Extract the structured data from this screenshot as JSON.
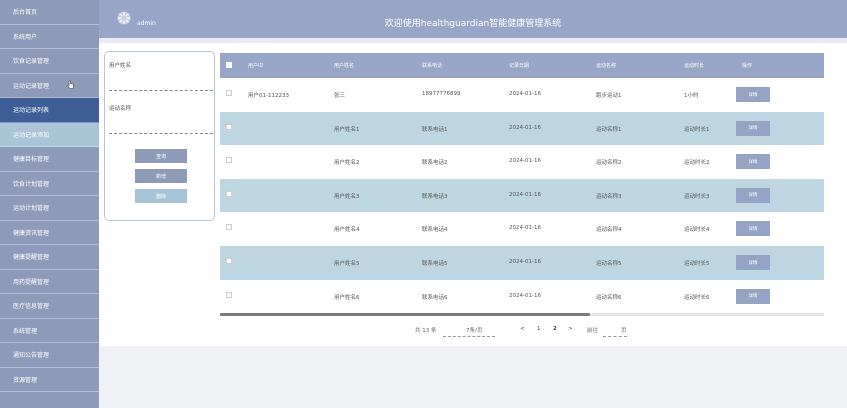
{
  "sidebar": {
    "items": [
      {
        "label": "后台首页",
        "state": "normal"
      },
      {
        "label": "系统用户",
        "state": "normal"
      },
      {
        "label": "饮食记录管理",
        "state": "normal"
      },
      {
        "label": "运动记录管理",
        "state": "normal"
      },
      {
        "label": "运动记录列表",
        "state": "active"
      },
      {
        "label": "运动记录添加",
        "state": "current"
      },
      {
        "label": "健康目标管理",
        "state": "normal"
      },
      {
        "label": "饮食计划管理",
        "state": "normal"
      },
      {
        "label": "运动计划管理",
        "state": "normal"
      },
      {
        "label": "健康资讯管理",
        "state": "normal"
      },
      {
        "label": "健康提醒管理",
        "state": "normal"
      },
      {
        "label": "用药提醒管理",
        "state": "normal"
      },
      {
        "label": "医疗信息管理",
        "state": "normal"
      },
      {
        "label": "系统管理",
        "state": "normal"
      },
      {
        "label": "通知公告管理",
        "state": "normal"
      },
      {
        "label": "资源管理",
        "state": "normal"
      }
    ]
  },
  "header": {
    "user": "admin",
    "welcome": "欢迎使用healthguardian智能健康管理系统"
  },
  "search": {
    "username_label": "用户姓名",
    "sport_label": "运动名称",
    "query_label": "查询",
    "add_label": "新增",
    "delete_label": "删除"
  },
  "table": {
    "columns": [
      "用户ID",
      "用户姓名",
      "联系电话",
      "记录日期",
      "运动名称",
      "运动时长",
      "操作"
    ],
    "detail_label": "详情",
    "rows": [
      {
        "id": "用户01-112233",
        "name": "张三",
        "phone": "18977776899",
        "date": "2024-01-16",
        "sport": "跑步运动1",
        "duration": "1小时"
      },
      {
        "id": "",
        "name": "用户姓名1",
        "phone": "联系电话1",
        "date": "2024-01-16",
        "sport": "运动名称1",
        "duration": "运动时长1"
      },
      {
        "id": "",
        "name": "用户姓名2",
        "phone": "联系电话2",
        "date": "2024-01-16",
        "sport": "运动名称2",
        "duration": "运动时长2"
      },
      {
        "id": "",
        "name": "用户姓名3",
        "phone": "联系电话3",
        "date": "2024-01-16",
        "sport": "运动名称3",
        "duration": "运动时长3"
      },
      {
        "id": "",
        "name": "用户姓名4",
        "phone": "联系电话4",
        "date": "2024-01-16",
        "sport": "运动名称4",
        "duration": "运动时长4"
      },
      {
        "id": "",
        "name": "用户姓名5",
        "phone": "联系电话5",
        "date": "2024-01-16",
        "sport": "运动名称5",
        "duration": "运动时长5"
      },
      {
        "id": "",
        "name": "用户姓名6",
        "phone": "联系电话6",
        "date": "2024-01-16",
        "sport": "运动名称6",
        "duration": "运动时长6"
      }
    ]
  },
  "pagination": {
    "total": "共 13 条",
    "page_size": "7条/页",
    "prev": "<",
    "page1": "1",
    "page2": "2",
    "next": ">",
    "goto": "前往",
    "page_unit": "页"
  },
  "colors": {
    "sidebar": "#8d9ab8",
    "active": "#3f5e97",
    "header": "#97a6c6",
    "row_alt": "#bdd6e1"
  }
}
